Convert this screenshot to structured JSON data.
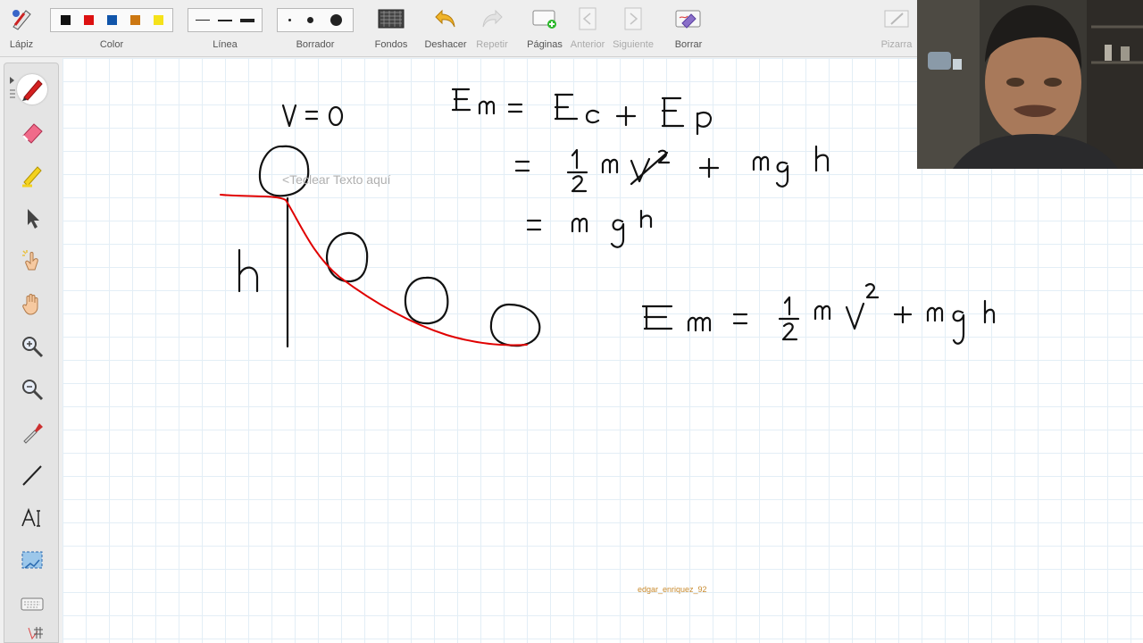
{
  "toolbar": {
    "pencil_label": "Lápiz",
    "color_label": "Color",
    "colors": [
      "#111111",
      "#dd1111",
      "#1155aa",
      "#cc7711",
      "#f5e21a"
    ],
    "line_label": "Línea",
    "eraser_label": "Borrador",
    "backgrounds_label": "Fondos",
    "undo_label": "Deshacer",
    "redo_label": "Repetir",
    "pages_label": "Páginas",
    "previous_label": "Anterior",
    "next_label": "Siguiente",
    "clear_label": "Borrar",
    "board_label": "Pizarra"
  },
  "canvas": {
    "text_placeholder": "<Teclear Texto aquí",
    "watermark": "edgar_enriquez_92"
  },
  "handwriting": {
    "velocity": "V = 0",
    "height_label": "h",
    "eq1_lhs": "Em",
    "eq1_rhs": "= Ec + Ep",
    "eq2": "= ½ m v² + m g h",
    "eq3": "= m g h",
    "eq4": "Em = ½ m v² + m g h"
  },
  "sidebar": {
    "tools": [
      "pen-tool",
      "highlighter-tool",
      "marker-tool",
      "select-tool",
      "laser-pointer-tool",
      "pan-tool",
      "zoom-in-tool",
      "zoom-out-tool",
      "color-picker-tool",
      "line-tool",
      "text-tool",
      "screenshot-tool",
      "keyboard-tool",
      "grid-tool"
    ]
  },
  "colors": {
    "ink": "#111111",
    "red_ink": "#e00000",
    "grid": "#e3eef6"
  }
}
